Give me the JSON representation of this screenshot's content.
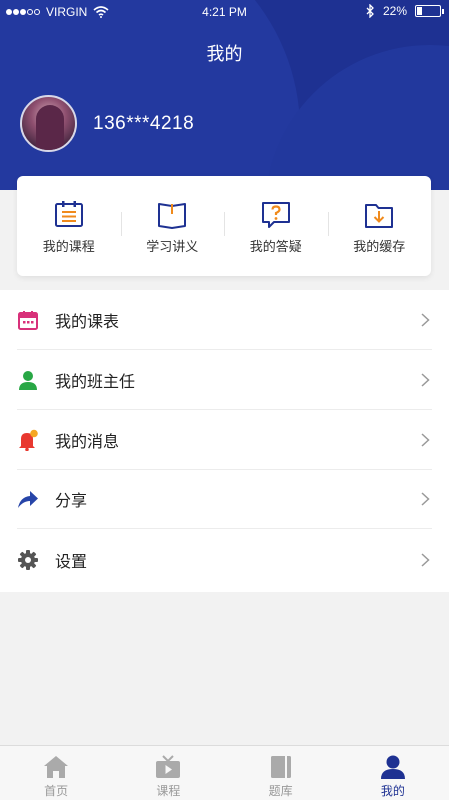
{
  "status_bar": {
    "carrier": "VIRGIN",
    "time": "4:21 PM",
    "battery": "22%",
    "battery_level": 0.22
  },
  "header": {
    "title": "我的",
    "phone": "136***4218"
  },
  "quick_actions": [
    {
      "label": "我的课程",
      "icon": "course-list-icon"
    },
    {
      "label": "学习讲义",
      "icon": "open-book-icon"
    },
    {
      "label": "我的答疑",
      "icon": "question-bubble-icon"
    },
    {
      "label": "我的缓存",
      "icon": "download-folder-icon"
    }
  ],
  "menu": [
    {
      "label": "我的课表",
      "icon": "calendar-icon",
      "color": "#d8317a"
    },
    {
      "label": "我的班主任",
      "icon": "person-icon",
      "color": "#28a745"
    },
    {
      "label": "我的消息",
      "icon": "bell-icon",
      "color": "#e8382f"
    },
    {
      "label": "分享",
      "icon": "share-arrow-icon",
      "color": "#2745a8"
    },
    {
      "label": "设置",
      "icon": "gear-icon",
      "color": "#555555"
    }
  ],
  "tabs": [
    {
      "label": "首页",
      "icon": "home-icon",
      "active": false
    },
    {
      "label": "课程",
      "icon": "tv-icon",
      "active": false
    },
    {
      "label": "题库",
      "icon": "book-icon",
      "active": false
    },
    {
      "label": "我的",
      "icon": "user-icon",
      "active": true
    }
  ],
  "colors": {
    "brand": "#1e3192",
    "accent_orange": "#f08a1c",
    "tab_inactive": "#aaaaaa"
  }
}
